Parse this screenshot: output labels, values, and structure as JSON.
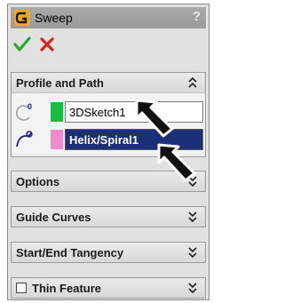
{
  "panel": {
    "title": "Sweep",
    "help_label": "?"
  },
  "actions": {
    "ok_icon": "check-icon",
    "cancel_icon": "close-icon"
  },
  "profile_and_path": {
    "label": "Profile and Path",
    "profile_value": "3DSketch1",
    "path_value": "Helix/Spiral1",
    "profile_color": "#12c03e",
    "path_color": "#f08ccd"
  },
  "sections": {
    "options": "Options",
    "guide_curves": "Guide Curves",
    "tangency": "Start/End Tangency",
    "thin_feature": "Thin Feature"
  },
  "colors": {
    "selection_highlight": "#1c2f7a",
    "panel_background": "#e1e1e1"
  }
}
